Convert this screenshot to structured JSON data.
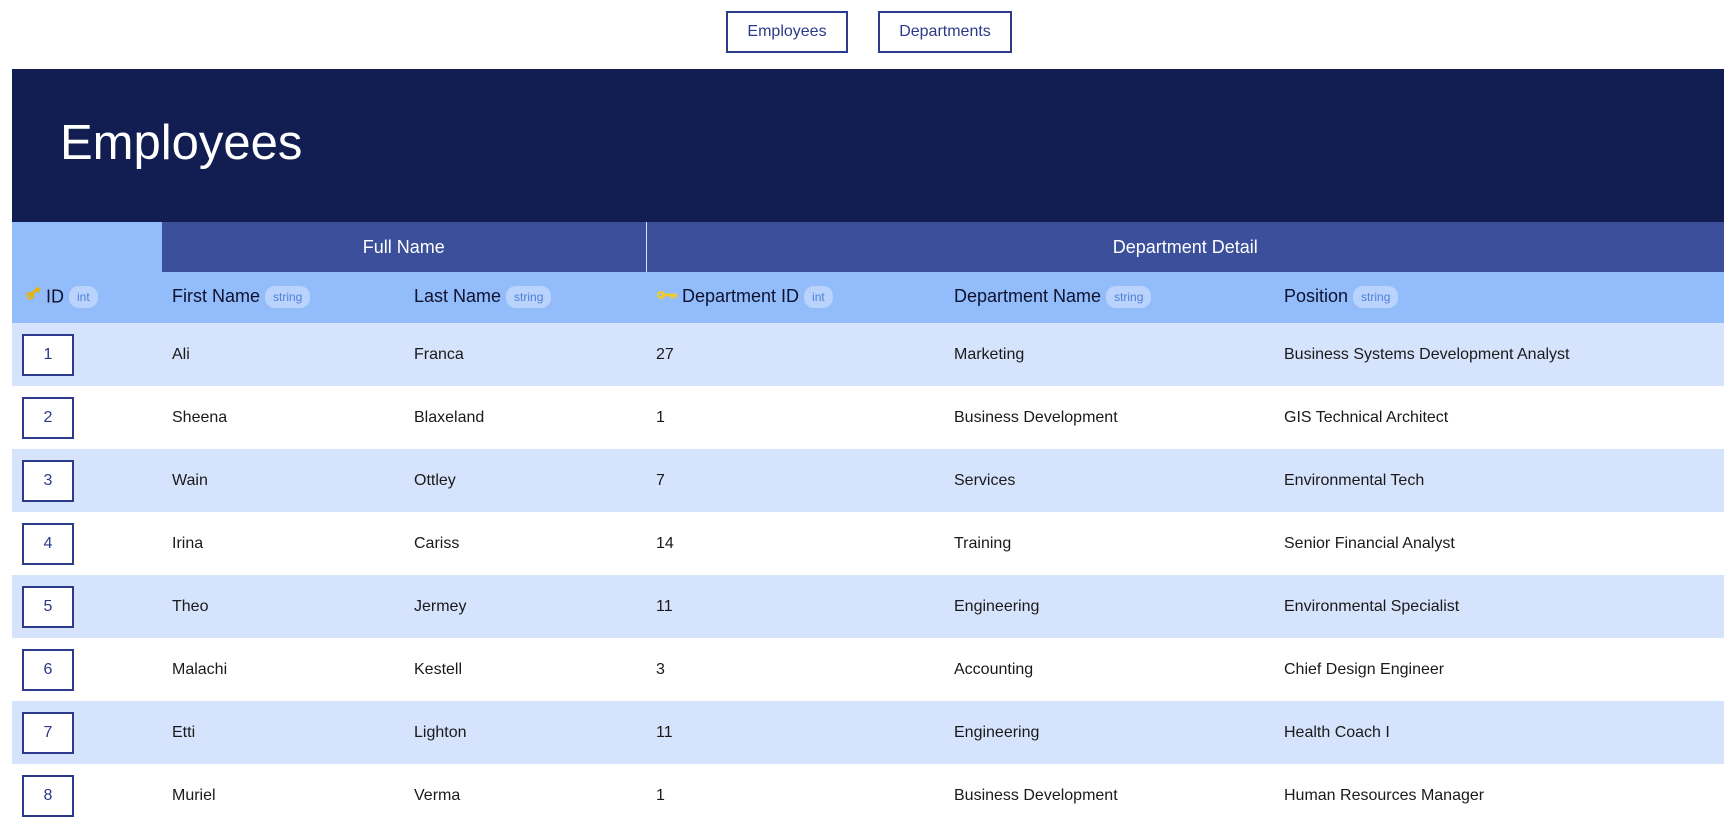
{
  "nav": {
    "employees_label": "Employees",
    "departments_label": "Departments"
  },
  "page": {
    "title": "Employees"
  },
  "table": {
    "groups": {
      "full_name": "Full Name",
      "department_detail": "Department Detail"
    },
    "columns": {
      "id": {
        "label": "ID",
        "type": "int"
      },
      "first_name": {
        "label": "First Name",
        "type": "string"
      },
      "last_name": {
        "label": "Last Name",
        "type": "string"
      },
      "department_id": {
        "label": "Department ID",
        "type": "int"
      },
      "department_name": {
        "label": "Department Name",
        "type": "string"
      },
      "position": {
        "label": "Position",
        "type": "string"
      }
    },
    "icons": {
      "primary_key": "key-icon",
      "foreign_key": "key-icon"
    },
    "rows": [
      {
        "id": "1",
        "first_name": "Ali",
        "last_name": "Franca",
        "department_id": "27",
        "department_name": "Marketing",
        "position": "Business Systems Development Analyst"
      },
      {
        "id": "2",
        "first_name": "Sheena",
        "last_name": "Blaxeland",
        "department_id": "1",
        "department_name": "Business Development",
        "position": "GIS Technical Architect"
      },
      {
        "id": "3",
        "first_name": "Wain",
        "last_name": "Ottley",
        "department_id": "7",
        "department_name": "Services",
        "position": "Environmental Tech"
      },
      {
        "id": "4",
        "first_name": "Irina",
        "last_name": "Cariss",
        "department_id": "14",
        "department_name": "Training",
        "position": "Senior Financial Analyst"
      },
      {
        "id": "5",
        "first_name": "Theo",
        "last_name": "Jermey",
        "department_id": "11",
        "department_name": "Engineering",
        "position": "Environmental Specialist"
      },
      {
        "id": "6",
        "first_name": "Malachi",
        "last_name": "Kestell",
        "department_id": "3",
        "department_name": "Accounting",
        "position": "Chief Design Engineer"
      },
      {
        "id": "7",
        "first_name": "Etti",
        "last_name": "Lighton",
        "department_id": "11",
        "department_name": "Engineering",
        "position": "Health Coach I"
      },
      {
        "id": "8",
        "first_name": "Muriel",
        "last_name": "Verma",
        "department_id": "1",
        "department_name": "Business Development",
        "position": "Human Resources Manager"
      }
    ]
  },
  "colors": {
    "banner": "#121e52",
    "group_header": "#3b4f9a",
    "column_header": "#93bcfb",
    "row_stripe": "#d5e3fc",
    "accent": "#2b3a8a",
    "primary_key_icon": "#e8b400",
    "foreign_key_icon": "#f2cc2a"
  }
}
